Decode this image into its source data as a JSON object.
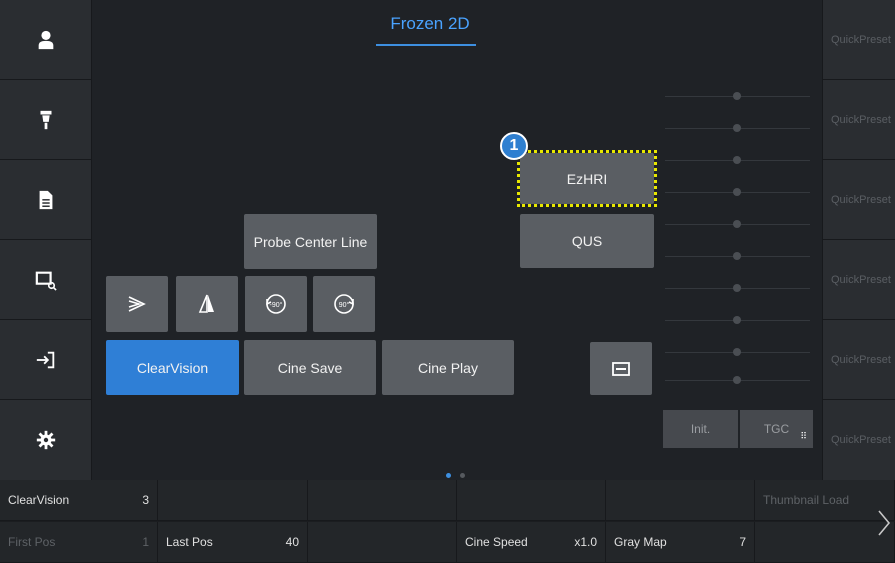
{
  "title": "Frozen 2D",
  "left_nav": [
    {
      "icon": "patient-icon"
    },
    {
      "icon": "probe-icon"
    },
    {
      "icon": "report-icon"
    },
    {
      "icon": "review-icon"
    },
    {
      "icon": "exit-icon"
    },
    {
      "icon": "settings-icon"
    }
  ],
  "presets": [
    "QuickPreset",
    "QuickPreset",
    "QuickPreset",
    "QuickPreset",
    "QuickPreset",
    "QuickPreset"
  ],
  "buttons": {
    "ezhri": "EzHRI",
    "qus": "QUS",
    "probe_center_line": "Probe Center Line",
    "clearvision": "ClearVision",
    "cine_save": "Cine Save",
    "cine_play": "Cine Play",
    "init": "Init.",
    "tgc": "TGC"
  },
  "callout_number": "1",
  "bottom": {
    "row1": [
      {
        "label": "ClearVision",
        "value": "3"
      },
      {
        "label": "",
        "value": ""
      },
      {
        "label": "",
        "value": ""
      },
      {
        "label": "",
        "value": ""
      },
      {
        "label": "",
        "value": ""
      },
      {
        "label": "Thumbnail Load",
        "value": ""
      }
    ],
    "row2": [
      {
        "label": "First Pos",
        "value": "1"
      },
      {
        "label": "Last Pos",
        "value": "40"
      },
      {
        "label": "",
        "value": ""
      },
      {
        "label": "Cine Speed",
        "value": "x1.0"
      },
      {
        "label": "Gray Map",
        "value": "7"
      },
      {
        "label": "",
        "value": ""
      }
    ]
  },
  "colors": {
    "accent": "#2f7fd6",
    "highlight": "#e8e800",
    "title": "#4aa3ff"
  }
}
